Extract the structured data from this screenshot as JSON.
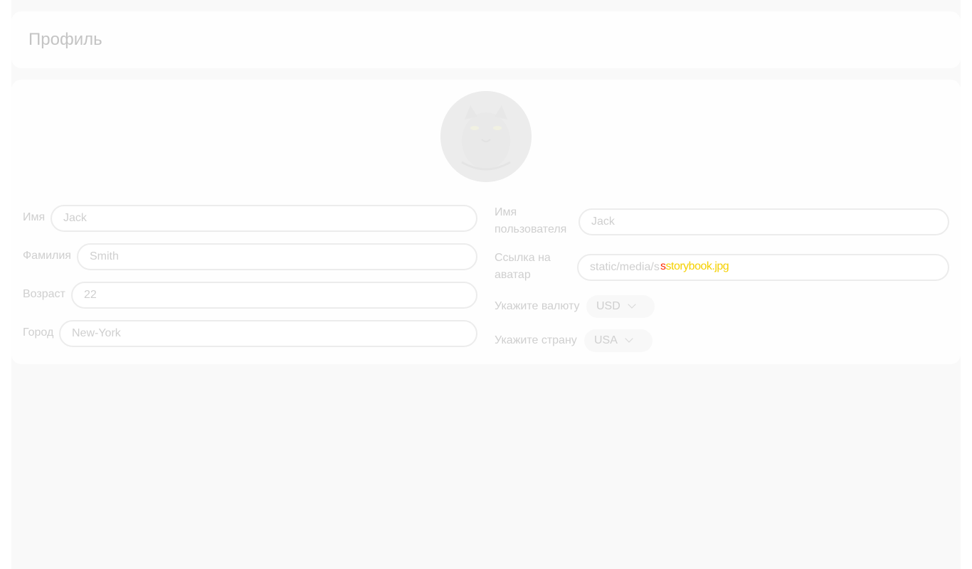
{
  "header": {
    "title": "Профиль"
  },
  "profile": {
    "avatar": {
      "icon": "cat-avatar-image"
    },
    "left_fields": [
      {
        "label": "Имя",
        "value": "Jack"
      },
      {
        "label": "Фамилия",
        "value": "Smith"
      },
      {
        "label": "Возраст",
        "value": "22"
      },
      {
        "label": "Город",
        "value": "New-York"
      }
    ],
    "right_fields": {
      "username": {
        "label_line1": "Имя",
        "label_line2": "пользователя",
        "value": "Jack"
      },
      "avatar_link": {
        "label_line1": "Ссылка на",
        "label_line2": "аватар",
        "value": "static/media/s",
        "overlay": "storybook.jpg"
      },
      "currency": {
        "label": "Укажите валюту",
        "value": "USD"
      },
      "country": {
        "label": "Укажите страну",
        "value": "USA"
      }
    }
  },
  "colors": {
    "page_bg": "#f9f9f9",
    "card_bg": "#fefefe",
    "muted_text": "#cfcfcf",
    "input_border": "#ececec"
  }
}
